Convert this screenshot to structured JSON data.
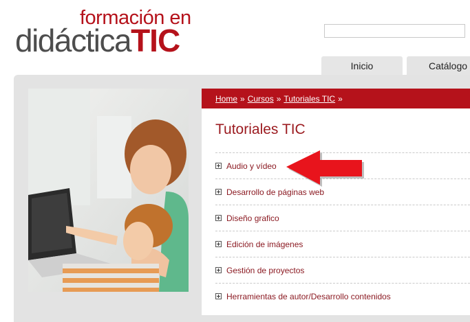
{
  "logo": {
    "line1": "formación en",
    "line2_part1": "didáctica",
    "line2_part2": "TIC"
  },
  "search": {
    "value": "",
    "placeholder": ""
  },
  "tabs": [
    {
      "label": "Inicio"
    },
    {
      "label": "Catálogo"
    }
  ],
  "breadcrumb": {
    "items": [
      "Home",
      "Cursos",
      "Tutoriales TIC"
    ],
    "separator": "»"
  },
  "page_title": "Tutoriales TIC",
  "categories": [
    "Audio y vídeo",
    "Desarrollo de páginas web",
    "Diseño grafico",
    "Edición de imágenes",
    "Gestión de proyectos",
    "Herramientas de autor/Desarrollo contenidos"
  ],
  "colors": {
    "brand_red": "#b5121b",
    "logo_gray": "#4d4d4d",
    "panel_gray": "#e3e3e3",
    "link_red": "#8b1a22",
    "arrow_red": "#e8141c"
  },
  "icons": {
    "expand": "plus-square-icon",
    "callout": "red-arrow-left-icon"
  }
}
